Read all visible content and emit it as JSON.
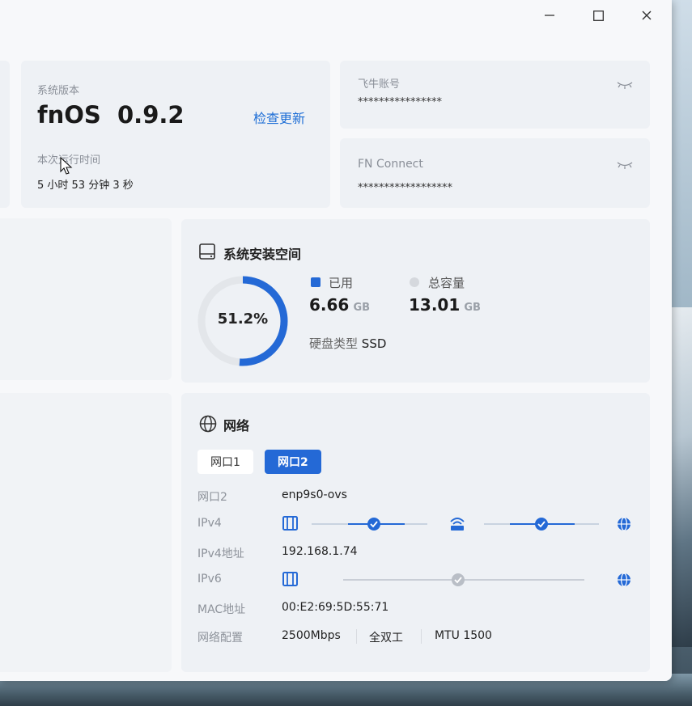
{
  "window": {
    "controls": {
      "minimize": "minimize",
      "maximize": "maximize",
      "close": "close"
    }
  },
  "system": {
    "version_label": "系统版本",
    "version_value": "fnOS  0.9.2",
    "check_update": "检查更新",
    "uptime_label": "本次运行时间",
    "uptime_value": "5 小时 53 分钟 3 秒"
  },
  "account": {
    "label": "飞牛账号",
    "masked_value": "****************"
  },
  "fn_connect": {
    "label": "FN Connect",
    "masked_value": "******************"
  },
  "storage": {
    "title": "系统安装空间",
    "percent_text": "51.2%",
    "percent_value": 51.2,
    "used_label": "已用",
    "used_value": "6.66",
    "used_unit": "GB",
    "total_label": "总容量",
    "total_value": "13.01",
    "total_unit": "GB",
    "disk_type_label": "硬盘类型",
    "disk_type_value": "SSD",
    "colors": {
      "used": "#2469d6",
      "track": "#e3e6ea",
      "total": "#d5d8dd"
    }
  },
  "network": {
    "title": "网络",
    "tabs": [
      {
        "label": "网口1",
        "active": false
      },
      {
        "label": "网口2",
        "active": true
      }
    ],
    "rows": {
      "port_label": "网口2",
      "port_value": "enp9s0-ovs",
      "ipv4_label": "IPv4",
      "ipv4_addr_label": "IPv4地址",
      "ipv4_addr_value": "192.168.1.74",
      "ipv6_label": "IPv6",
      "mac_label": "MAC地址",
      "mac_value": "00:E2:69:5D:55:71",
      "config_label": "网络配置",
      "speed": "2500Mbps",
      "duplex": "全双工",
      "mtu": "MTU 1500"
    },
    "accent": "#2469d6"
  }
}
